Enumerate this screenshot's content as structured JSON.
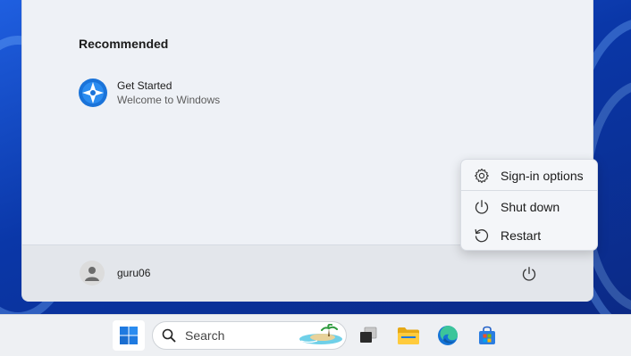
{
  "recommended": {
    "title": "Recommended",
    "items": [
      {
        "name": "Get Started",
        "subtitle": "Welcome to Windows",
        "icon": "get-started-icon"
      }
    ]
  },
  "user": {
    "name": "guru06",
    "icon": "user-avatar-icon"
  },
  "power_menu": {
    "items": [
      {
        "label": "Sign-in options",
        "icon": "gear-icon"
      },
      {
        "label": "Shut down",
        "icon": "power-icon"
      },
      {
        "label": "Restart",
        "icon": "restart-icon"
      }
    ]
  },
  "taskbar": {
    "search_placeholder": "Search",
    "apps": [
      "start-icon",
      "task-view-icon",
      "file-explorer-icon",
      "edge-icon",
      "store-icon"
    ]
  },
  "colors": {
    "accent": "#0067c0",
    "menu_bg": "#eef1f6",
    "footer_bg": "#e3e6eb",
    "wallpaper": "#0a37a8"
  }
}
